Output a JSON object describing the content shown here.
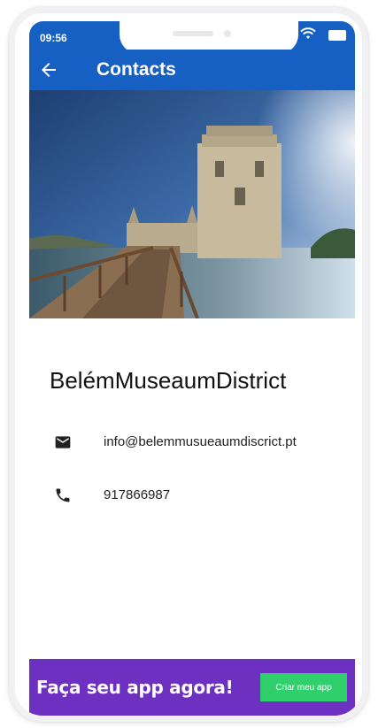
{
  "status_bar": {
    "time": "09:56"
  },
  "appbar": {
    "title": "Contacts"
  },
  "contact": {
    "name": "BelémMuseaumDistrict",
    "email": "info@belemmusueaumdiscrict.pt",
    "phone": "917866987"
  },
  "banner": {
    "text": "Faça seu app agora!",
    "button_label": "Criar meu app"
  },
  "colors": {
    "primary": "#1560c2",
    "banner": "#6d30c1",
    "banner_button": "#2fcf6b"
  }
}
